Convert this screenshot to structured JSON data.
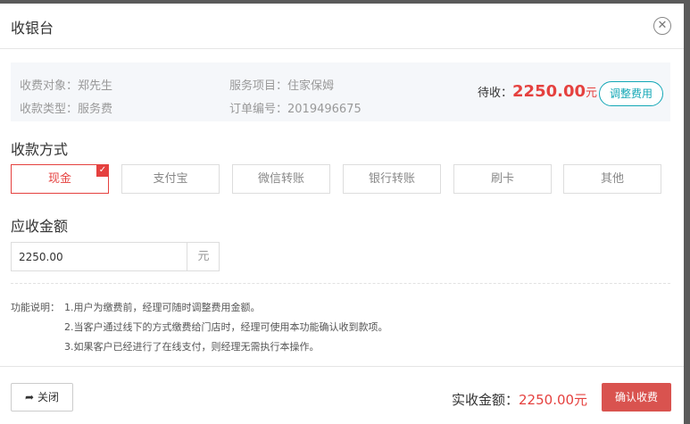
{
  "dialog": {
    "title": "收银台",
    "close_icon": "circle-close-icon"
  },
  "info": {
    "payer_label": "收费对象：",
    "payer_value": "郑先生",
    "service_label": "服务项目：",
    "service_value": "住家保姆",
    "type_label": "收款类型：",
    "type_value": "服务费",
    "order_label": "订单编号：",
    "order_value": "2019496675",
    "pending_label": "待收：",
    "pending_amount": "2250.00",
    "pending_unit": "元",
    "adjust_button": "调整费用"
  },
  "payment": {
    "title": "收款方式",
    "methods": [
      "现金",
      "支付宝",
      "微信转账",
      "银行转账",
      "刷卡",
      "其他"
    ],
    "selected": "现金",
    "check_icon": "check-icon"
  },
  "receivable": {
    "title": "应收金额",
    "value": "2250.00",
    "unit": "元"
  },
  "notes": {
    "label": "功能说明：",
    "lines": [
      "1.用户为缴费前，经理可随时调整费用金额。",
      "2.当客户通过线下的方式缴费给门店时，经理可使用本功能确认收到款项。",
      "3.如果客户已经进行了在线支付，则经理无需执行本操作。"
    ]
  },
  "footer": {
    "close_label": "关闭",
    "close_icon": "reply-arrow-icon",
    "actual_label": "实收金额：",
    "actual_value": "2250.00",
    "actual_unit": "元",
    "confirm_label": "确认收费"
  },
  "colors": {
    "accent": "#e5413f",
    "teal": "#13a7b6",
    "confirm": "#d9534f"
  }
}
